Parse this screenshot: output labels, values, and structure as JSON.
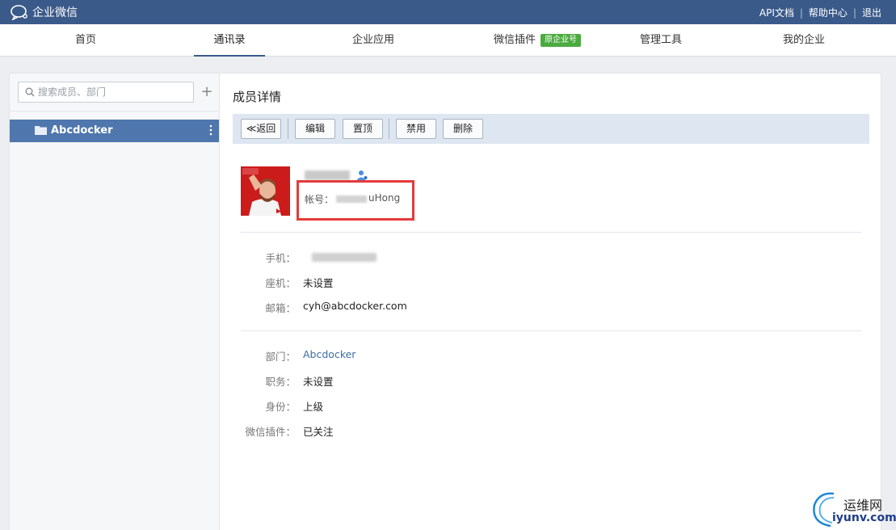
{
  "app": {
    "title": "企业微信"
  },
  "top_links": {
    "api": "API文档",
    "help": "帮助中心",
    "logout": "退出"
  },
  "nav": {
    "items": [
      {
        "label": "首页"
      },
      {
        "label": "通讯录"
      },
      {
        "label": "企业应用"
      },
      {
        "label": "微信插件",
        "badge": "原企业号"
      },
      {
        "label": "管理工具"
      },
      {
        "label": "我的企业"
      }
    ],
    "active_index": 1
  },
  "sidebar": {
    "search_placeholder": "搜索成员、部门",
    "departments": [
      {
        "label": "Abcdocker"
      }
    ]
  },
  "detail": {
    "title": "成员详情",
    "toolbar": {
      "back": "≪返回",
      "edit": "编辑",
      "top": "置顶",
      "disable": "禁用",
      "delete": "删除"
    },
    "account_label": "帐号：",
    "account_value_visible": "uHong",
    "contact": [
      {
        "key": "手机：",
        "value": ""
      },
      {
        "key": "座机：",
        "value": "未设置"
      },
      {
        "key": "邮箱：",
        "value": "cyh@abcdocker.com"
      }
    ],
    "org": [
      {
        "key": "部门：",
        "value": "Abcdocker"
      },
      {
        "key": "职务：",
        "value": "未设置"
      },
      {
        "key": "身份：",
        "value": "上级"
      },
      {
        "key": "微信插件：",
        "value": "已关注"
      }
    ]
  },
  "watermark": {
    "cn": "运维网",
    "en": "iyunv.com"
  },
  "colors": {
    "topbar": "#3a5a8a",
    "selected_dept": "#4f77ad",
    "badge": "#4aab3f",
    "highlight": "#e53a3a",
    "link": "#3a6ea5"
  }
}
